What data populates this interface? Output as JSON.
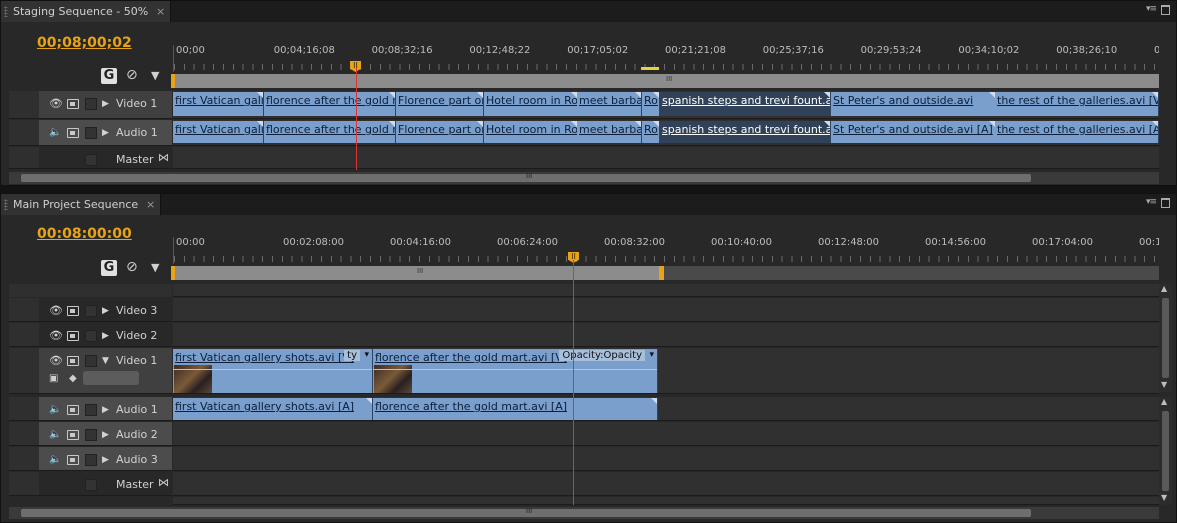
{
  "colors": {
    "accent": "#e8a317",
    "clip": "#7a9fcd",
    "clip_selected": "#314258",
    "playhead": "#dd3333"
  },
  "staging": {
    "tab_label": "Staging Sequence - 50%",
    "close_glyph": "×",
    "timecode": "00;08;00;02",
    "ruler_labels": [
      "00;00",
      "00;04;16;08",
      "00;08;32;16",
      "00;12;48;22",
      "00;17;05;02",
      "00;21;21;08",
      "00;25;37;16",
      "00;29;53;24",
      "00;34;10;02",
      "00;38;26;10",
      "00;42;4"
    ],
    "zoom_grip": "III",
    "scroll_grip": "III",
    "tracks": [
      {
        "name": "Video 1",
        "kind": "video"
      },
      {
        "name": "Audio 1",
        "kind": "audio"
      },
      {
        "name": "Master",
        "kind": "master"
      }
    ],
    "video_clips": [
      {
        "label": "first Vatican galle",
        "start": 0,
        "end": 0.092
      },
      {
        "label": "florence after the gold m",
        "start": 0.092,
        "end": 0.226
      },
      {
        "label": "Florence part one",
        "start": 0.226,
        "end": 0.315
      },
      {
        "label": "Hotel room in Rom",
        "start": 0.315,
        "end": 0.41
      },
      {
        "label": "meet barba",
        "start": 0.41,
        "end": 0.476
      },
      {
        "label": "Ro",
        "start": 0.476,
        "end": 0.494
      },
      {
        "label": "spanish steps and trevi fount.avi",
        "start": 0.494,
        "end": 0.667,
        "selected": true
      },
      {
        "label": "St Peter's and outside.avi",
        "start": 0.667,
        "end": 0.834
      },
      {
        "label": "the rest of the galleries.avi [V]",
        "start": 0.834,
        "end": 1.0
      }
    ],
    "audio_clips": [
      {
        "label": "first Vatican galle",
        "start": 0,
        "end": 0.092
      },
      {
        "label": "florence after the gold m",
        "start": 0.092,
        "end": 0.226
      },
      {
        "label": "Florence part one",
        "start": 0.226,
        "end": 0.315
      },
      {
        "label": "Hotel room in Rom",
        "start": 0.315,
        "end": 0.41
      },
      {
        "label": "meet barba",
        "start": 0.41,
        "end": 0.476
      },
      {
        "label": "Ro",
        "start": 0.476,
        "end": 0.494
      },
      {
        "label": "spanish steps and trevi fount.avi",
        "start": 0.494,
        "end": 0.667,
        "selected": true
      },
      {
        "label": "St Peter's and outside.avi [A]",
        "start": 0.667,
        "end": 0.834
      },
      {
        "label": "the rest of the galleries.avi [A]",
        "start": 0.834,
        "end": 1.0
      }
    ],
    "playhead_fraction": 0.185
  },
  "main": {
    "tab_label": "Main Project Sequence",
    "close_glyph": "×",
    "timecode": "00:08:00:00",
    "ruler_labels": [
      "00:00",
      "00:02:08:00",
      "00:04:16:00",
      "00:06:24:00",
      "00:08:32:00",
      "00:10:40:00",
      "00:12:48:00",
      "00:14:56:00",
      "00:17:04:00",
      "00:19:12:0"
    ],
    "zoom_grip": "III",
    "scroll_grip": "III",
    "video_tracks": [
      {
        "name": "Video 3"
      },
      {
        "name": "Video 2"
      },
      {
        "name": "Video 1",
        "expanded": true
      }
    ],
    "audio_tracks": [
      {
        "name": "Audio 1"
      },
      {
        "name": "Audio 2"
      },
      {
        "name": "Audio 3"
      },
      {
        "name": "Master"
      }
    ],
    "video_clips": [
      {
        "label": "first Vatican gallery shots.avi [V]",
        "fx": "ty",
        "start": 0,
        "end": 0.203
      },
      {
        "label": "florence after the gold mart.avi [V]",
        "fx": "Opacity:Opacity",
        "start": 0.203,
        "end": 0.492
      }
    ],
    "audio_clips": [
      {
        "label": "first Vatican gallery shots.avi [A]",
        "start": 0,
        "end": 0.203
      },
      {
        "label": "florence after the gold mart.avi [A]",
        "start": 0.203,
        "end": 0.492
      }
    ],
    "playhead_fraction": 0.405
  }
}
